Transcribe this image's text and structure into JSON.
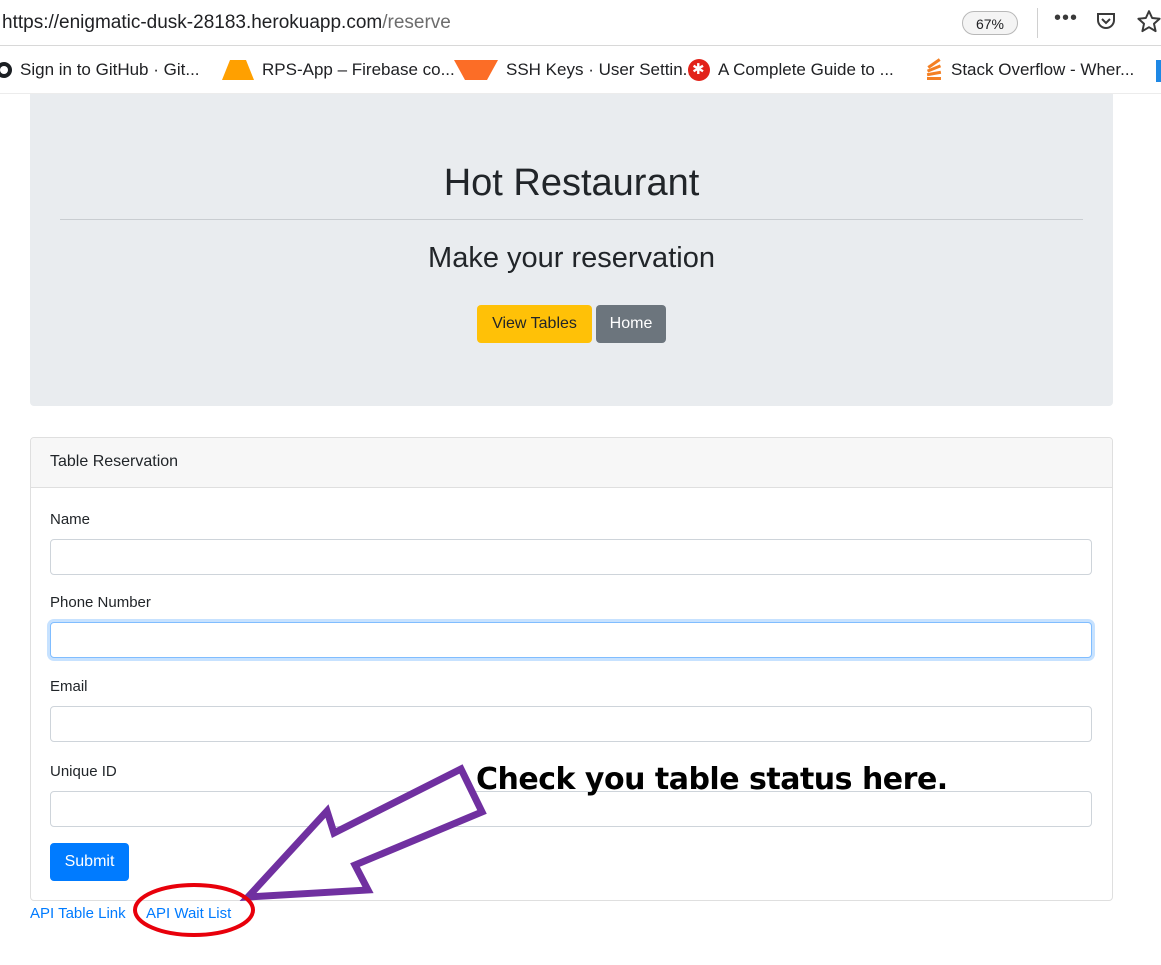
{
  "browser": {
    "url_host": "https://enigmatic-dusk-28183.herokuapp.com",
    "url_path": "/reserve",
    "zoom": "67%",
    "icons": [
      "more-icon",
      "pocket-icon",
      "bookmark-star-icon"
    ],
    "bookmarks": [
      {
        "label": "Sign in to GitHub · Git...",
        "icon": "github-icon"
      },
      {
        "label": "RPS-App – Firebase co...",
        "icon": "firebase-icon"
      },
      {
        "label": "SSH Keys · User Settin...",
        "icon": "gitlab-icon"
      },
      {
        "label": "A Complete Guide to ...",
        "icon": "guide-icon"
      },
      {
        "label": "Stack Overflow - Wher...",
        "icon": "stackoverflow-icon"
      }
    ]
  },
  "jumbotron": {
    "title": "Hot Restaurant",
    "subtitle": "Make your reservation",
    "view_tables_label": "View Tables",
    "home_label": "Home"
  },
  "reservation": {
    "header": "Table Reservation",
    "fields": [
      {
        "label": "Name",
        "value": ""
      },
      {
        "label": "Phone Number",
        "value": ""
      },
      {
        "label": "Email",
        "value": ""
      },
      {
        "label": "Unique ID",
        "value": ""
      }
    ],
    "submit_label": "Submit"
  },
  "footer_links": {
    "table_link": "API Table Link",
    "wait_list": "API Wait List"
  },
  "annotation": {
    "text": "Check you table status here.",
    "arrow_color": "#7030a0",
    "circle_color": "#e8000b"
  },
  "colors": {
    "warning": "#ffc107",
    "secondary": "#6c757d",
    "primary": "#007bff",
    "jumbotron_bg": "#e9ecef"
  }
}
